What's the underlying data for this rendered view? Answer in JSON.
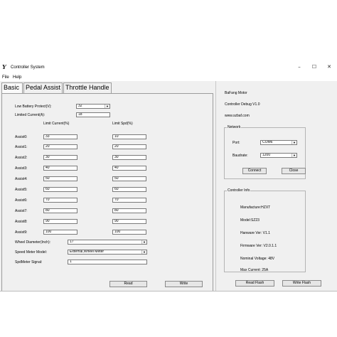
{
  "window": {
    "title": "Controller System",
    "icon_glyph": "Y",
    "controls": {
      "minimize": "–",
      "maximize": "☐",
      "close": "✕"
    }
  },
  "menu": {
    "file": "File",
    "help": "Help"
  },
  "tabs": [
    {
      "label": "Basic",
      "active": true
    },
    {
      "label": "Pedal Assist",
      "active": false
    },
    {
      "label": "Throttle Handle",
      "active": false
    }
  ],
  "basic": {
    "low_battery_label": "Low Battery Protect(V):",
    "low_battery_value": "32",
    "limited_current_label": "Limited Current(A):",
    "limited_current_value": "18",
    "col_limit_current": "Limit Current(%)",
    "col_limit_speed": "Limit Spd(%)",
    "assists": [
      {
        "label": "Assist0:",
        "current": "33",
        "speed": "10"
      },
      {
        "label": "Assist1:",
        "current": "20",
        "speed": "20"
      },
      {
        "label": "Assist2:",
        "current": "30",
        "speed": "30"
      },
      {
        "label": "Assist3:",
        "current": "40",
        "speed": "40"
      },
      {
        "label": "Assist4:",
        "current": "50",
        "speed": "50"
      },
      {
        "label": "Assist5:",
        "current": "60",
        "speed": "60"
      },
      {
        "label": "Assist6:",
        "current": "70",
        "speed": "70"
      },
      {
        "label": "Assist7:",
        "current": "80",
        "speed": "80"
      },
      {
        "label": "Assist8:",
        "current": "90",
        "speed": "90"
      },
      {
        "label": "Assist9:",
        "current": "100",
        "speed": "100"
      }
    ],
    "wheel_diameter_label": "Wheel Diameter(Inch):",
    "wheel_diameter_value": "17",
    "speed_meter_label": "Speed Meter Model:",
    "speed_meter_value": "External,Wheel Meter",
    "spdmeter_signal_label": "SpdMeter Signal:",
    "spdmeter_signal_value": "1",
    "read_button": "Read",
    "write_button": "Write"
  },
  "info": {
    "brand": "BaFang Motor",
    "debug": "Controller Debug V1.0",
    "website": "www.szbaf.com"
  },
  "network": {
    "title": "Network",
    "port_label": "Port:",
    "port_value": "COM6",
    "baudrate_label": "Baudrate:",
    "baudrate_value": "1200",
    "connect_button": "Connect",
    "close_button": "Close"
  },
  "controller_info": {
    "title": "Controller Info",
    "manufacturer": "Manufacture:HZXT",
    "model": "Model:SZ23",
    "hardware": "Hanware Ver: V1.1",
    "firmware": "Firmware Ver: V2.0.1.1",
    "voltage": "Nominal Voltage: 48V",
    "max_current": "Max Current: 25A"
  },
  "flash": {
    "read_button": "Read Flash",
    "write_button": "Write Flash"
  }
}
